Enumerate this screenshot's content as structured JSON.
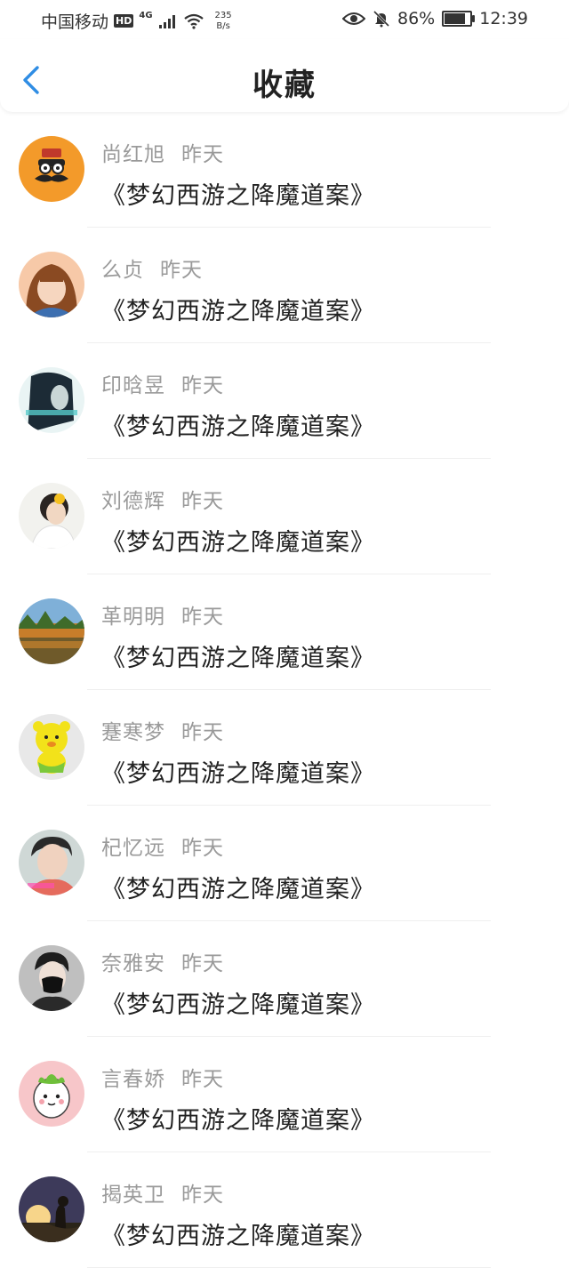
{
  "status_bar": {
    "carrier": "中国移动",
    "hd": "HD",
    "network": "4G",
    "speed_value": "235",
    "speed_unit": "B/s",
    "battery": "86%",
    "battery_level": 0.86,
    "time": "12:39",
    "icons": [
      "signal-icon",
      "wifi-icon",
      "eye-icon",
      "bell-muted-icon",
      "battery-icon"
    ]
  },
  "header": {
    "back_icon": "chevron-left-icon",
    "title": "收藏"
  },
  "colors": {
    "accent": "#2f8de4",
    "name_gray": "#9a9a9a",
    "text": "#222222"
  },
  "favorites": [
    {
      "name": "尚红旭",
      "time": "昨天",
      "title": "《梦幻西游之降魔道案》",
      "avatar": "cartoon-mustache-avatar"
    },
    {
      "name": "么贞",
      "time": "昨天",
      "title": "《梦幻西游之降魔道案》",
      "avatar": "anime-girl-avatar"
    },
    {
      "name": "印晗昱",
      "time": "昨天",
      "title": "《梦幻西游之降魔道案》",
      "avatar": "dark-portrait-avatar"
    },
    {
      "name": "刘德辉",
      "time": "昨天",
      "title": "《梦幻西游之降魔道案》",
      "avatar": "girl-flower-avatar"
    },
    {
      "name": "革明明",
      "time": "昨天",
      "title": "《梦幻西游之降魔道案》",
      "avatar": "autumn-lake-avatar"
    },
    {
      "name": "蹇寒梦",
      "time": "昨天",
      "title": "《梦幻西游之降魔道案》",
      "avatar": "yellow-toy-avatar"
    },
    {
      "name": "杞忆远",
      "time": "昨天",
      "title": "《梦幻西游之降魔道案》",
      "avatar": "young-man-avatar"
    },
    {
      "name": "奈雅安",
      "time": "昨天",
      "title": "《梦幻西游之降魔道案》",
      "avatar": "masked-man-avatar"
    },
    {
      "name": "言春娇",
      "time": "昨天",
      "title": "《梦幻西游之降魔道案》",
      "avatar": "cute-cartoon-avatar"
    },
    {
      "name": "揭英卫",
      "time": "昨天",
      "title": "《梦幻西游之降魔道案》",
      "avatar": "sunset-silhouette-avatar"
    }
  ]
}
